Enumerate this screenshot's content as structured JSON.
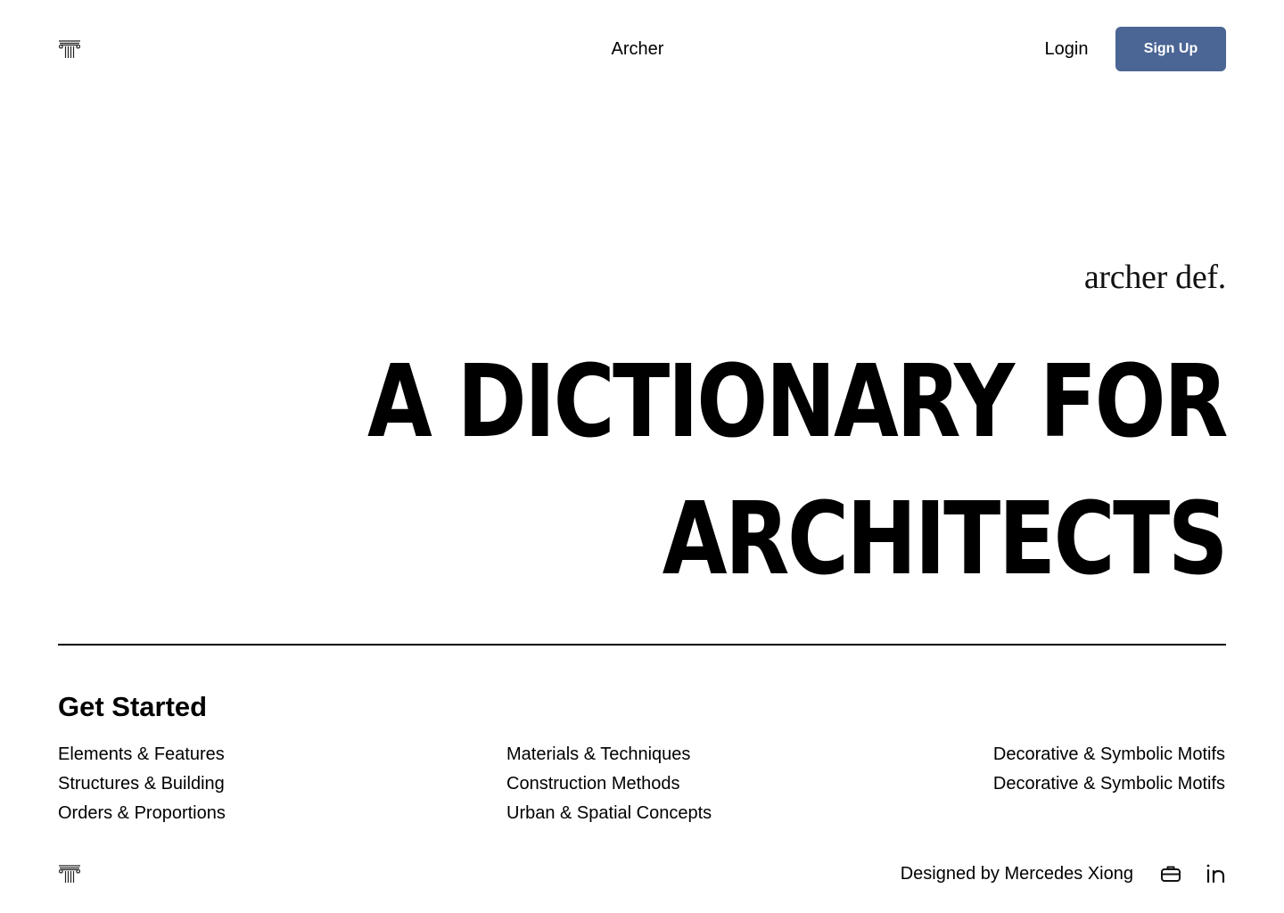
{
  "header": {
    "brand": "Archer",
    "login_label": "Login",
    "signup_label": "Sign Up",
    "logo_icon": "column-capital-icon"
  },
  "hero": {
    "tagline": "archer def.",
    "title_line1": "A DICTIONARY FOR",
    "title_line2": "ARCHITECTS"
  },
  "get_started": {
    "title": "Get Started",
    "columns": [
      {
        "items": [
          "Elements & Features",
          "Structures & Building",
          "Orders & Proportions"
        ]
      },
      {
        "items": [
          "Materials & Techniques",
          "Construction Methods",
          "Urban & Spatial Concepts"
        ]
      },
      {
        "items": [
          "Decorative & Symbolic Motifs",
          "Decorative & Symbolic Motifs"
        ]
      }
    ]
  },
  "footer": {
    "credit": "Designed by Mercedes Xiong",
    "icons": [
      "briefcase-icon",
      "linkedin-icon"
    ]
  },
  "colors": {
    "accent": "#4b6594",
    "text": "#000000",
    "background": "#ffffff"
  }
}
